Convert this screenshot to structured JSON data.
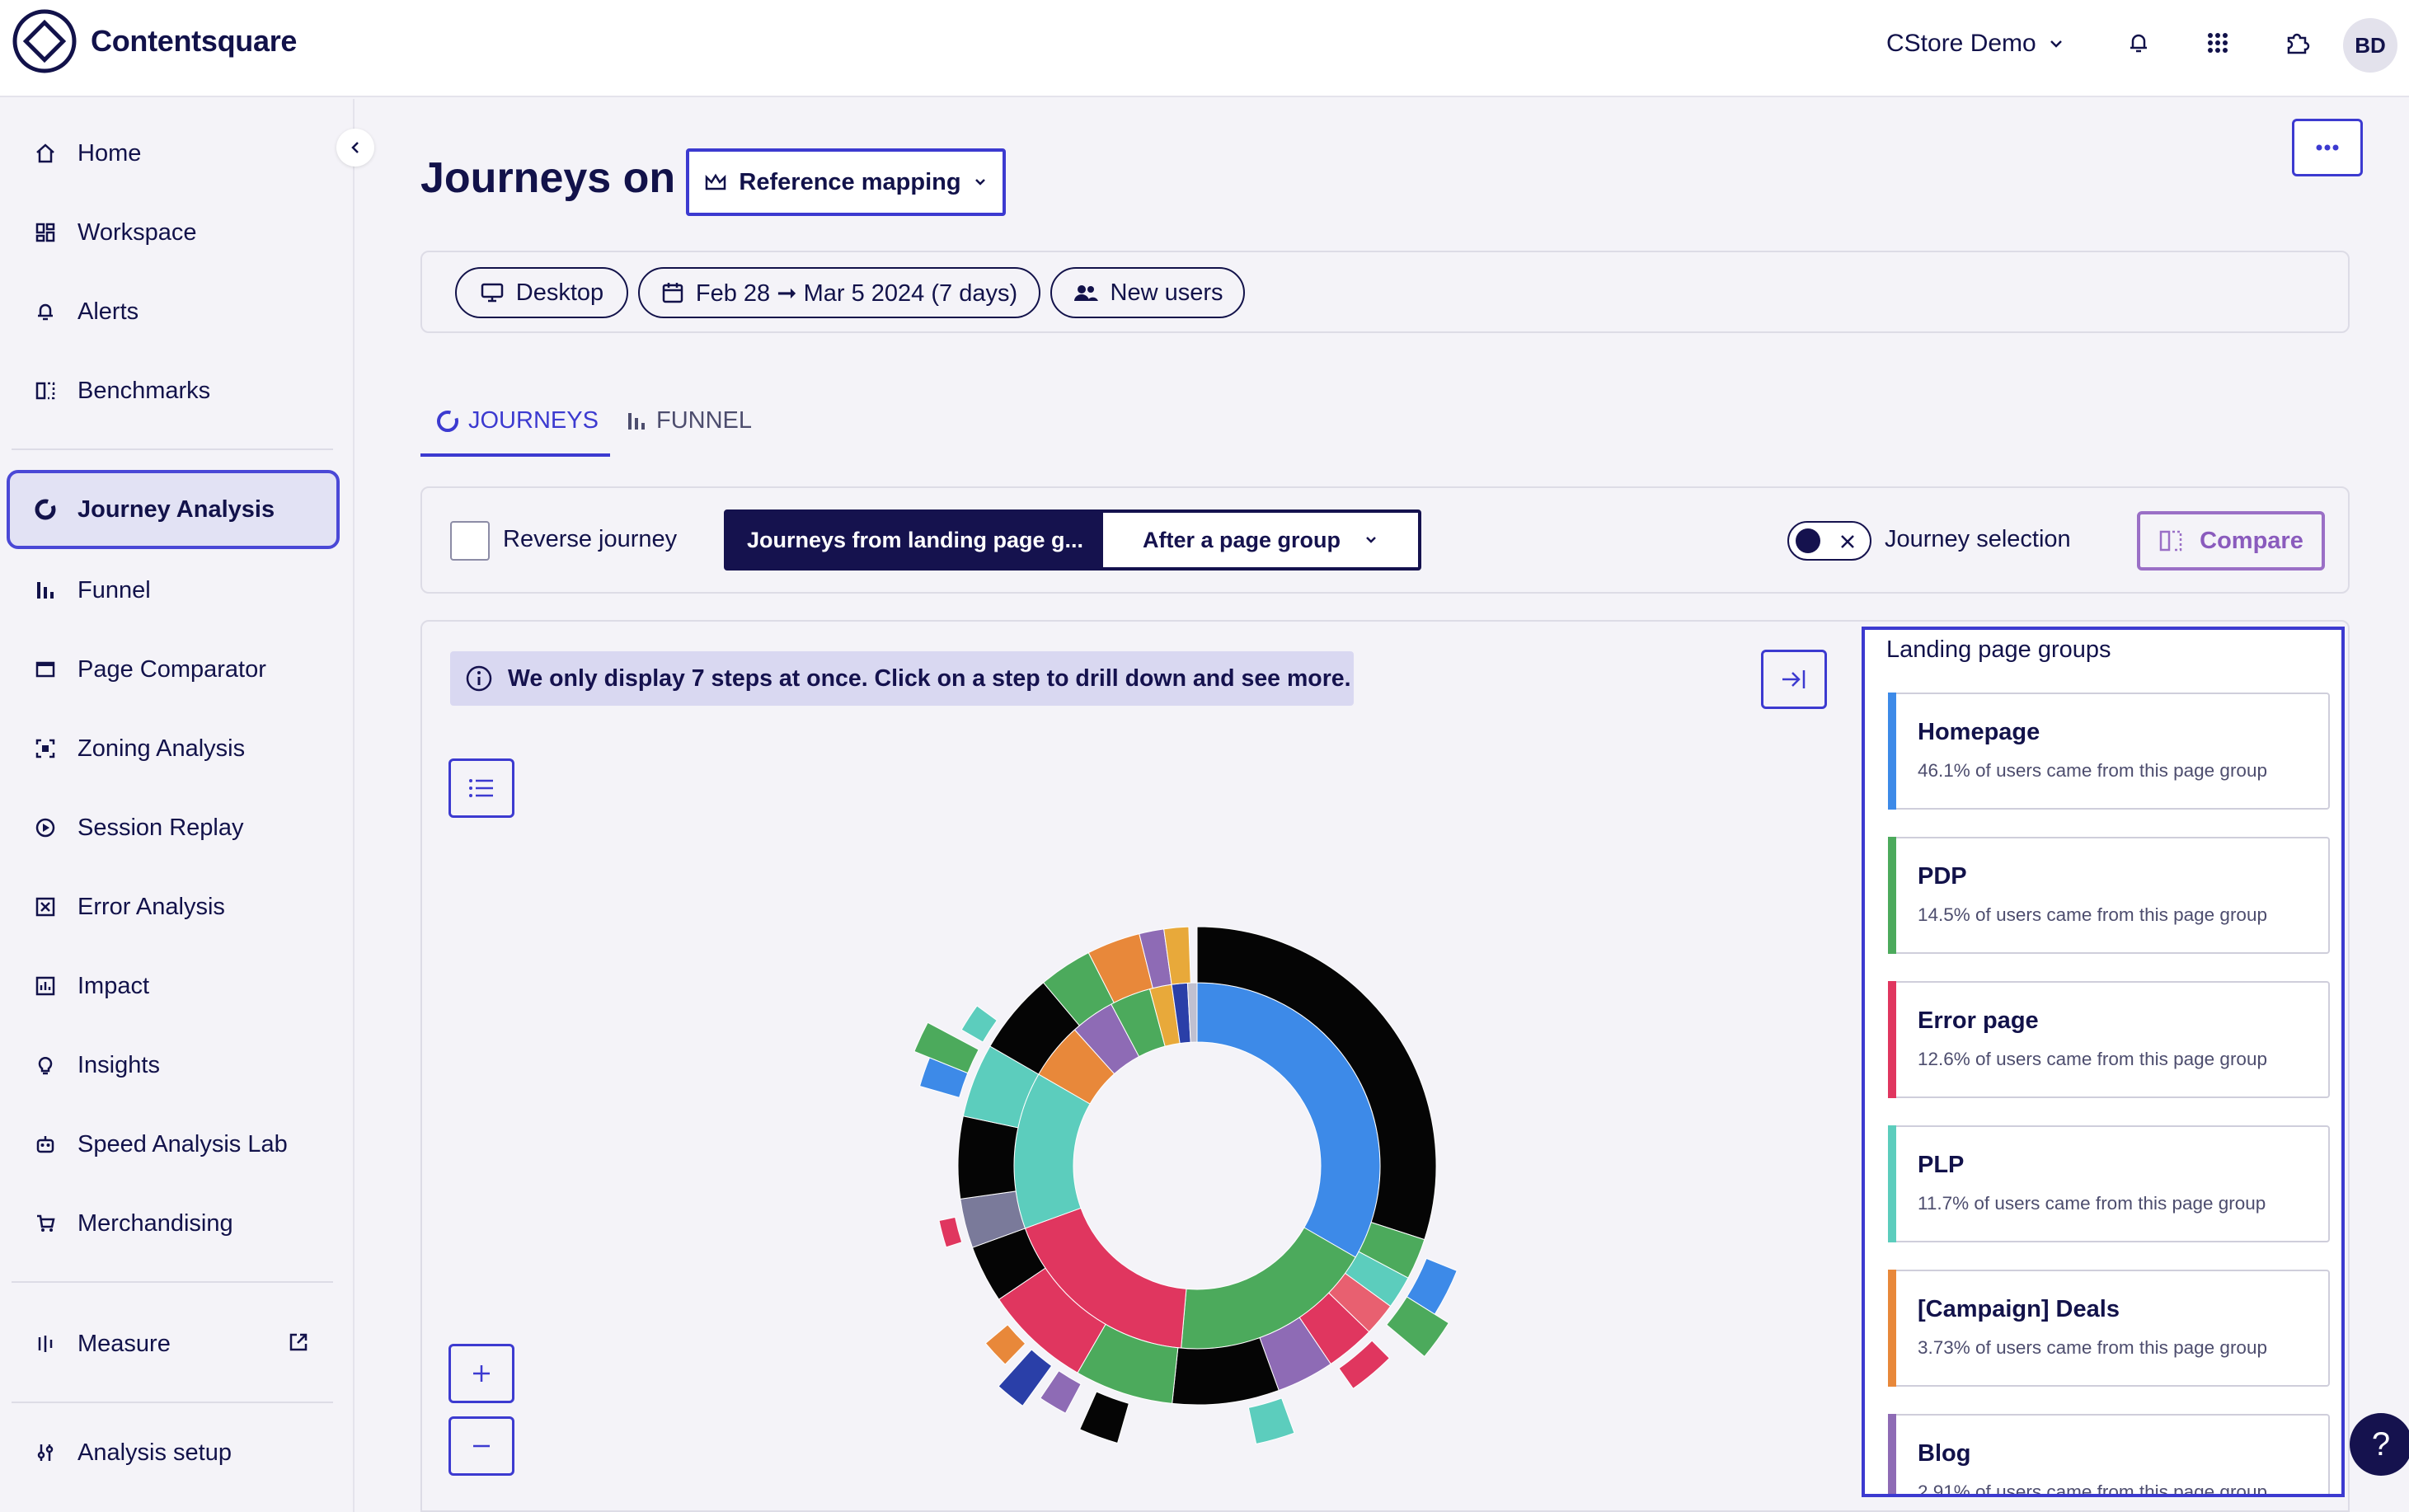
{
  "app": {
    "name": "Contentsquare",
    "project": "CStore Demo",
    "user_initials": "BD"
  },
  "sidebar": {
    "items": [
      {
        "label": "Home",
        "icon": "home-icon"
      },
      {
        "label": "Workspace",
        "icon": "workspace-icon"
      },
      {
        "label": "Alerts",
        "icon": "bell-icon"
      },
      {
        "label": "Benchmarks",
        "icon": "benchmarks-icon"
      },
      {
        "label": "Journey Analysis",
        "icon": "journey-icon",
        "active": true
      },
      {
        "label": "Funnel",
        "icon": "funnel-icon"
      },
      {
        "label": "Page Comparator",
        "icon": "page-comparator-icon"
      },
      {
        "label": "Zoning Analysis",
        "icon": "zoning-icon"
      },
      {
        "label": "Session Replay",
        "icon": "play-icon"
      },
      {
        "label": "Error Analysis",
        "icon": "error-icon"
      },
      {
        "label": "Impact",
        "icon": "impact-icon"
      },
      {
        "label": "Insights",
        "icon": "lightbulb-icon"
      },
      {
        "label": "Speed Analysis Lab",
        "icon": "robot-icon"
      },
      {
        "label": "Merchandising",
        "icon": "cart-icon"
      },
      {
        "label": "Measure",
        "icon": "measure-icon"
      },
      {
        "label": "Analysis setup",
        "icon": "sliders-icon"
      }
    ]
  },
  "header": {
    "title": "Journeys on",
    "mapping_label": "Reference mapping"
  },
  "filters": {
    "device": "Desktop",
    "date_range": "Feb 28 ➞ Mar 5 2024 (7 days)",
    "segment": "New users"
  },
  "tabs": [
    {
      "label": "JOURNEYS",
      "active": true
    },
    {
      "label": "FUNNEL",
      "active": false
    }
  ],
  "controls": {
    "reverse_label": "Reverse journey",
    "segment_a": "Journeys from landing page g...",
    "segment_b": "After a page group",
    "journey_selection_label": "Journey selection",
    "compare_label": "Compare"
  },
  "notice": "We only display 7 steps at once. Click on a step to drill down and see more.",
  "landing_groups": {
    "heading": "Landing page groups",
    "items": [
      {
        "name": "Homepage",
        "desc": "46.1% of users came from this page group",
        "color": "#3d8ae8"
      },
      {
        "name": "PDP",
        "desc": "14.5% of users came from this page group",
        "color": "#4caa5c"
      },
      {
        "name": "Error page",
        "desc": "12.6% of users came from this page group",
        "color": "#e0365f"
      },
      {
        "name": "PLP",
        "desc": "11.7% of users came from this page group",
        "color": "#5ccdbd"
      },
      {
        "name": "[Campaign] Deals",
        "desc": "3.73% of users came from this page group",
        "color": "#e8883a"
      },
      {
        "name": "Blog",
        "desc": "2.91% of users came from this page group",
        "color": "#8e6bb5"
      }
    ]
  },
  "help_label": "?"
}
